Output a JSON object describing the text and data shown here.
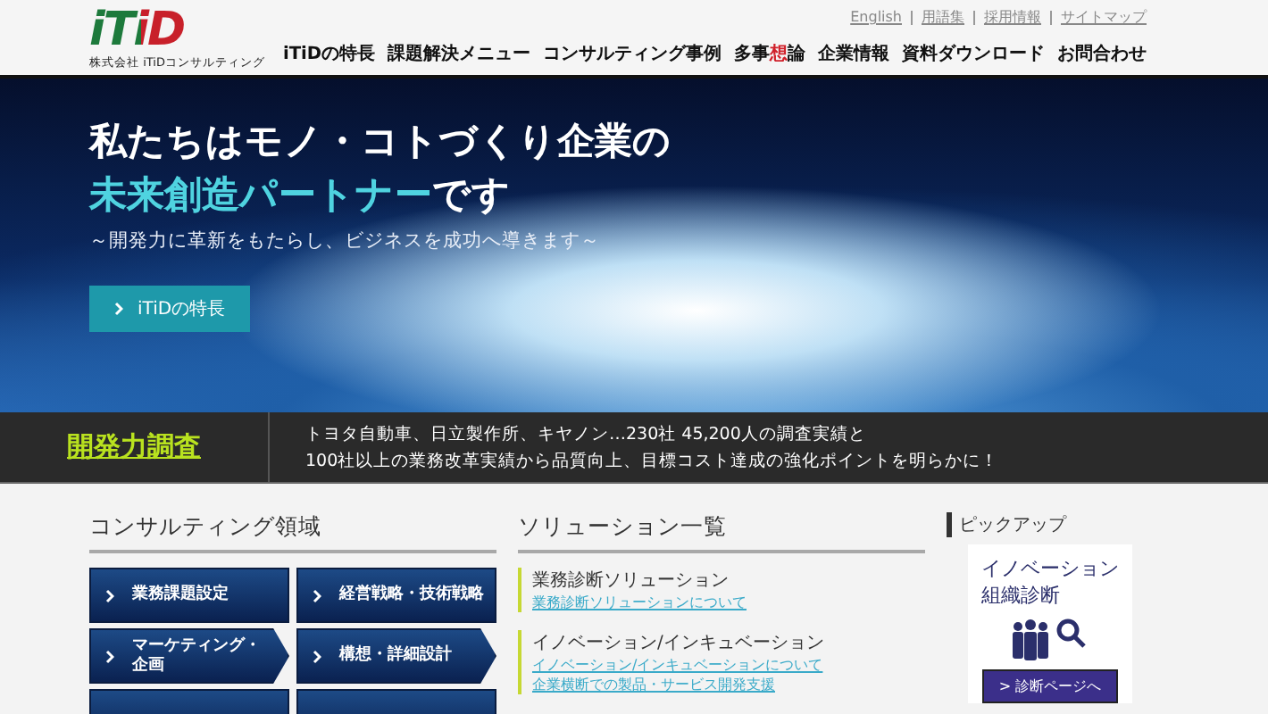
{
  "header": {
    "logo": "iTiD",
    "company": "株式会社 iTiDコンサルティング",
    "utility_links": [
      "English",
      "用語集",
      "採用情報",
      "サイトマップ"
    ],
    "nav": [
      {
        "parts": [
          {
            "text": "iTiDの特長",
            "accent": false
          }
        ]
      },
      {
        "parts": [
          {
            "text": "課題解決メニュー",
            "accent": false
          }
        ]
      },
      {
        "parts": [
          {
            "text": "コンサルティング事例",
            "accent": false
          }
        ]
      },
      {
        "parts": [
          {
            "text": "多事",
            "accent": false
          },
          {
            "text": "想",
            "accent": true
          },
          {
            "text": "論",
            "accent": false
          }
        ]
      },
      {
        "parts": [
          {
            "text": "企業情報",
            "accent": false
          }
        ]
      },
      {
        "parts": [
          {
            "text": "資料ダウンロード",
            "accent": false
          }
        ]
      },
      {
        "parts": [
          {
            "text": "お問合わせ",
            "accent": false
          }
        ]
      }
    ]
  },
  "hero": {
    "line1": "私たちはモノ・コトづくり企業の",
    "line2_accent": "未来創造パートナー",
    "line2_rest": "です",
    "subtitle": "～開発力に革新をもたらし、ビジネスを成功へ導きます～",
    "button": "iTiDの特長"
  },
  "survey": {
    "title": "開発力調査",
    "lines": [
      "トヨタ自動車、日立製作所、キヤノン…230社 45,200人の調査実績と",
      "100社以上の業務改革実績から品質向上、目標コスト達成の強化ポイントを明らかに！"
    ]
  },
  "consulting": {
    "heading": "コンサルティング領域",
    "buttons": [
      {
        "label": "業務課題設定",
        "kind": "plain"
      },
      {
        "label": "経営戦略・技術戦略",
        "kind": "plain"
      },
      {
        "label": "マーケティング・企画",
        "kind": "arrow"
      },
      {
        "label": "構想・詳細設計",
        "kind": "arrow"
      },
      {
        "kind": "plain"
      },
      {
        "kind": "plain"
      }
    ]
  },
  "solutions": {
    "heading": "ソリューション一覧",
    "items": [
      {
        "title": "業務診断ソリューション",
        "links": [
          "業務診断ソリューションについて"
        ]
      },
      {
        "title": "イノベーション/インキュベーション",
        "links": [
          "イノベーション/インキュベーションについて",
          "企業横断での製品・サービス開発支援"
        ]
      }
    ]
  },
  "pickup": {
    "heading": "ピックアップ",
    "card_title_lines": [
      "イノベーション",
      "組織診断"
    ],
    "button": "> 診断ページへ"
  }
}
